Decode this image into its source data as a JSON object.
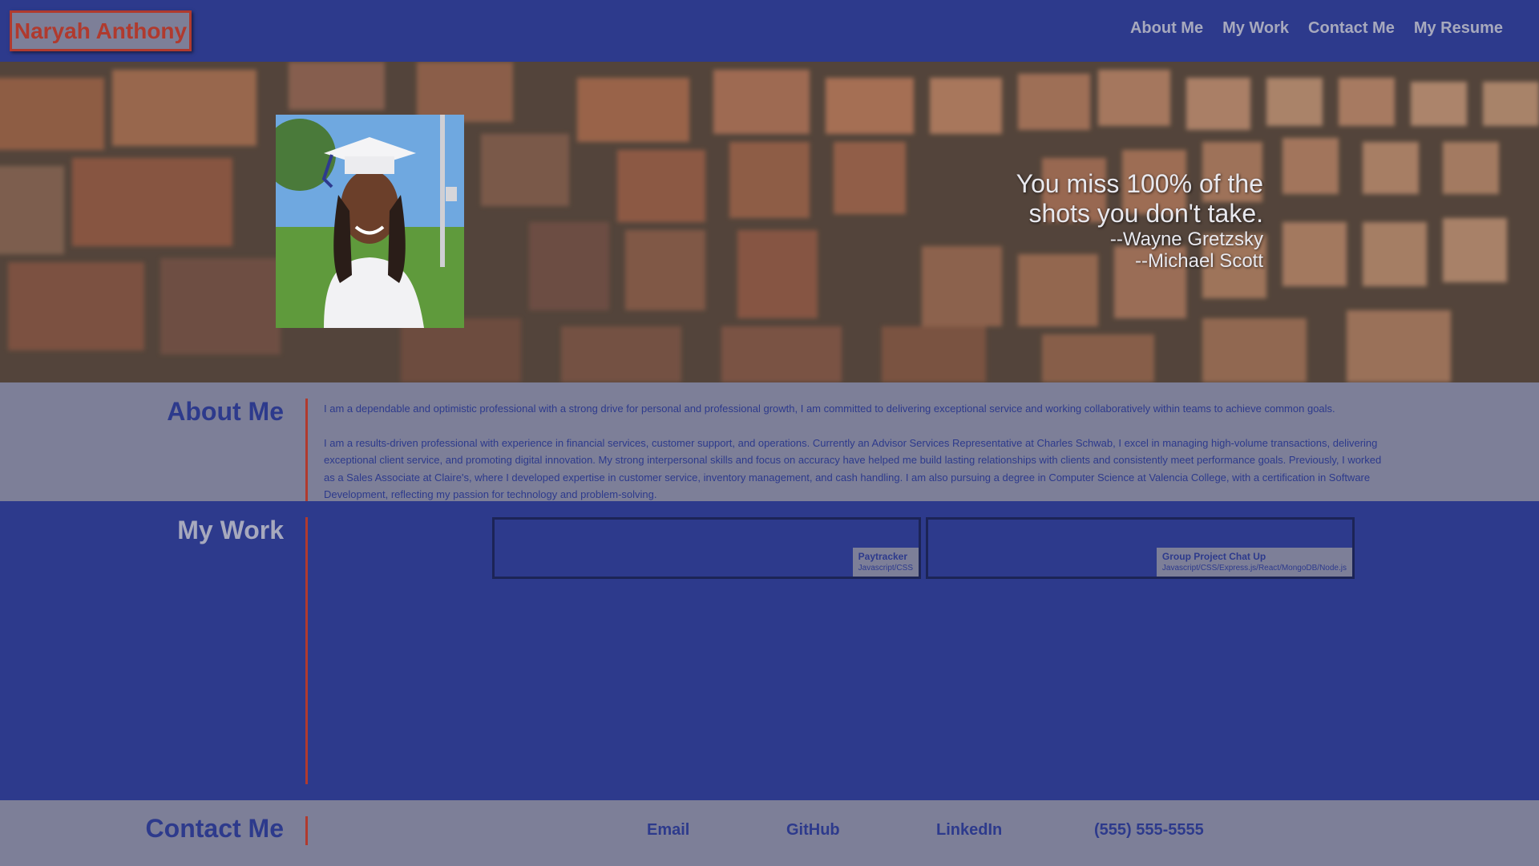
{
  "header": {
    "brand": "Naryah Anthony",
    "nav": [
      "About Me",
      "My Work",
      "Contact Me",
      "My Resume"
    ]
  },
  "hero": {
    "quote_line1": "You miss 100% of the",
    "quote_line2": "shots you don't take.",
    "attribution1": "--Wayne Gretzsky",
    "attribution2": "--Michael Scott"
  },
  "about": {
    "title": "About Me",
    "paragraph1": "I am a dependable and optimistic professional with a strong drive for personal and professional growth, I am committed to delivering exceptional service and working collaboratively within teams to achieve common goals.",
    "paragraph2": "I am a results-driven professional with experience in financial services, customer support, and operations. Currently an Advisor Services Representative at Charles Schwab, I excel in managing high-volume transactions, delivering exceptional client service, and promoting digital innovation. My strong interpersonal skills and focus on accuracy have helped me build lasting relationships with clients and consistently meet performance goals. Previously, I worked as a Sales Associate at Claire's, where I developed expertise in customer service, inventory management, and cash handling. I am also pursuing a degree in Computer Science at Valencia College, with a certification in Software Development, reflecting my passion for technology and problem-solving."
  },
  "work": {
    "title": "My Work",
    "projects": [
      {
        "name": "Paytracker",
        "tech": "Javascript/CSS"
      },
      {
        "name": "Group Project Chat Up",
        "tech": "Javascript/CSS/Express.js/React/MongoDB/Node.js"
      }
    ]
  },
  "contact": {
    "title": "Contact Me",
    "email": "Email",
    "github": "GitHub",
    "linkedin": "LinkedIn",
    "phone": "(555) 555-5555"
  },
  "colors": {
    "primary_blue": "#2d3a8c",
    "gray": "#7d7f98",
    "accent_red": "#b03a2e"
  }
}
